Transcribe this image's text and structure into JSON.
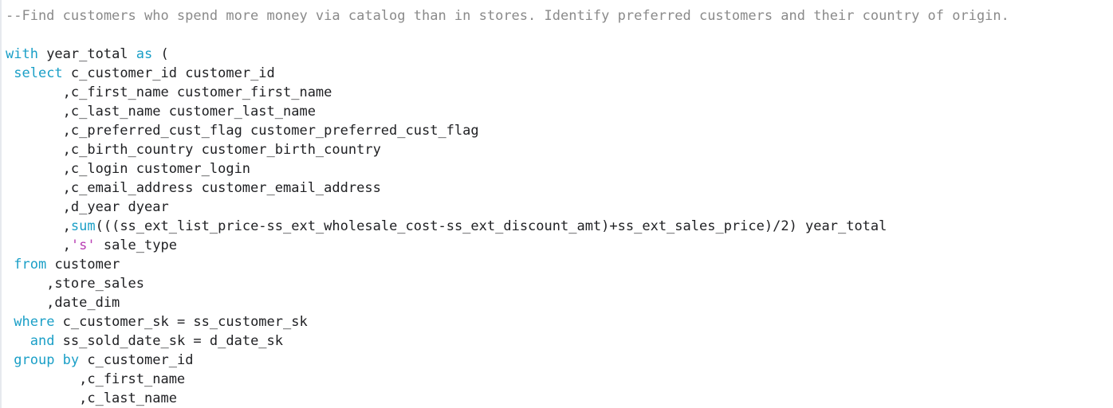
{
  "editor": {
    "lines": [
      [
        {
          "t": "comment",
          "v": "--Find customers who spend more money via catalog than in stores. Identify preferred customers and their country of origin."
        }
      ],
      [],
      [
        {
          "t": "kw",
          "v": "with"
        },
        {
          "t": "plain",
          "v": " year_total "
        },
        {
          "t": "kw",
          "v": "as"
        },
        {
          "t": "plain",
          "v": " ("
        }
      ],
      [
        {
          "t": "plain",
          "v": " "
        },
        {
          "t": "kw",
          "v": "select"
        },
        {
          "t": "plain",
          "v": " c_customer_id customer_id"
        }
      ],
      [
        {
          "t": "plain",
          "v": "       ,c_first_name customer_first_name"
        }
      ],
      [
        {
          "t": "plain",
          "v": "       ,c_last_name customer_last_name"
        }
      ],
      [
        {
          "t": "plain",
          "v": "       ,c_preferred_cust_flag customer_preferred_cust_flag"
        }
      ],
      [
        {
          "t": "plain",
          "v": "       ,c_birth_country customer_birth_country"
        }
      ],
      [
        {
          "t": "plain",
          "v": "       ,c_login customer_login"
        }
      ],
      [
        {
          "t": "plain",
          "v": "       ,c_email_address customer_email_address"
        }
      ],
      [
        {
          "t": "plain",
          "v": "       ,d_year dyear"
        }
      ],
      [
        {
          "t": "plain",
          "v": "       ,"
        },
        {
          "t": "fn",
          "v": "sum"
        },
        {
          "t": "plain",
          "v": "(((ss_ext_list_price-ss_ext_wholesale_cost-ss_ext_discount_amt)+ss_ext_sales_price)/2) year_total"
        }
      ],
      [
        {
          "t": "plain",
          "v": "       ,"
        },
        {
          "t": "str",
          "v": "'s'"
        },
        {
          "t": "plain",
          "v": " sale_type"
        }
      ],
      [
        {
          "t": "plain",
          "v": " "
        },
        {
          "t": "kw",
          "v": "from"
        },
        {
          "t": "plain",
          "v": " customer"
        }
      ],
      [
        {
          "t": "plain",
          "v": "     ,store_sales"
        }
      ],
      [
        {
          "t": "plain",
          "v": "     ,date_dim"
        }
      ],
      [
        {
          "t": "plain",
          "v": " "
        },
        {
          "t": "kw",
          "v": "where"
        },
        {
          "t": "plain",
          "v": " c_customer_sk = ss_customer_sk"
        }
      ],
      [
        {
          "t": "plain",
          "v": "   "
        },
        {
          "t": "kw",
          "v": "and"
        },
        {
          "t": "plain",
          "v": " ss_sold_date_sk = d_date_sk"
        }
      ],
      [
        {
          "t": "plain",
          "v": " "
        },
        {
          "t": "kw",
          "v": "group by"
        },
        {
          "t": "plain",
          "v": " c_customer_id"
        }
      ],
      [
        {
          "t": "plain",
          "v": "         ,c_first_name"
        }
      ],
      [
        {
          "t": "plain",
          "v": "         ,c_last_name"
        }
      ]
    ]
  },
  "colors": {
    "keyword": "#1a9fc7",
    "function": "#1a9fc7",
    "string": "#b83db3",
    "comment": "#8a8a8a",
    "text": "#202124",
    "background": "#ffffff"
  }
}
